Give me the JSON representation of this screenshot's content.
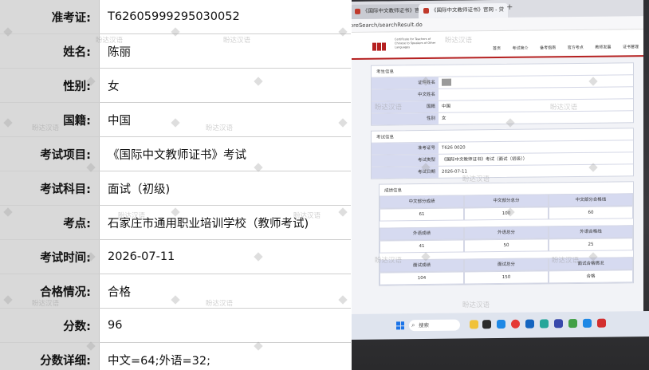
{
  "info": {
    "rows": [
      {
        "label": "准考证:",
        "value": "T62605999295030052"
      },
      {
        "label": "姓名:",
        "value": "陈丽"
      },
      {
        "label": "性别:",
        "value": "女"
      },
      {
        "label": "国籍:",
        "value": "中国"
      },
      {
        "label": "考试项目:",
        "value": "《国际中文教师证书》考试"
      },
      {
        "label": "考试科目:",
        "value": "面试（初级)"
      },
      {
        "label": "考点:",
        "value": "石家庄市通用职业培训学校（教师考试)"
      },
      {
        "label": "考试时间:",
        "value": "2026-07-11"
      },
      {
        "label": "合格情况:",
        "value": "合格"
      },
      {
        "label": "分数:",
        "value": "96"
      },
      {
        "label": "分数详细:",
        "value": "中文=64;外语=32;"
      }
    ]
  },
  "watermark": {
    "text": "盼达汉语"
  },
  "photo": {
    "tabs": [
      "《国际中文教师证书》官网 - 贷",
      "《国际中文教师证书》官网 - 贷"
    ],
    "url": "oreSearch/searchResult.do",
    "site_name": "Certificate for Teachers of Chinese to Speakers of Other Languages",
    "nav": [
      "首页",
      "考试简介",
      "备考指南",
      "官方考点",
      "教师发展",
      "证书管理"
    ],
    "candidate_panel": {
      "title": "考生信息",
      "rows": [
        {
          "k": "证件姓名",
          "v": ""
        },
        {
          "k": "中文姓名",
          "v": ""
        },
        {
          "k": "国籍",
          "v": "中国"
        },
        {
          "k": "性别",
          "v": "女"
        }
      ]
    },
    "exam_panel": {
      "title": "考试信息",
      "rows": [
        {
          "k": "准考证号",
          "v": "T626         0020"
        },
        {
          "k": "考试类型",
          "v": "《国际中文教师证书》考试（面试（初级））"
        },
        {
          "k": "考试日期",
          "v": "2026-07-11"
        }
      ]
    },
    "score_panel": {
      "title": "成绩信息",
      "tables": [
        {
          "head": [
            "中文部分成绩",
            "中文部分总分",
            "中文部分合格线"
          ],
          "vals": [
            "61",
            "100",
            "60"
          ]
        },
        {
          "head": [
            "外语成绩",
            "外语总分",
            "外语合格线"
          ],
          "vals": [
            "41",
            "50",
            "25"
          ]
        },
        {
          "head": [
            "面试成绩",
            "面试总分",
            "面试合格情况"
          ],
          "vals": [
            "104",
            "150",
            "合格"
          ]
        }
      ]
    },
    "taskbar": {
      "search_label": "搜索"
    }
  },
  "colors": {
    "label_bg": "#d9d9d9",
    "brand_red": "#b52020",
    "table_head": "#d6daf0"
  }
}
